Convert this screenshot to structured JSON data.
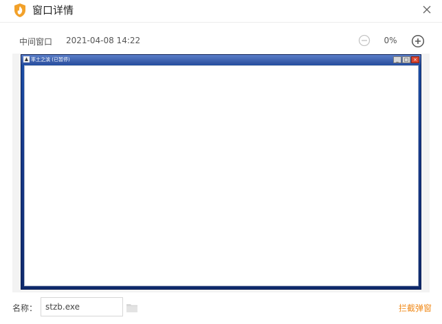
{
  "dialog": {
    "title": "窗口详情",
    "close_icon": "close-icon",
    "app_icon": "flame-shield-icon",
    "accent_color": "#f08a1a"
  },
  "info": {
    "window_type": "中间窗口",
    "timestamp": "2021-04-08 14:22",
    "zoom": "0%",
    "zoom_out_icon": "zoom-out-icon",
    "zoom_in_icon": "zoom-in-icon"
  },
  "preview": {
    "window_title": "率土之滨 (已暂停)",
    "controls": [
      "_",
      "□",
      "×"
    ]
  },
  "footer": {
    "name_label": "名称：",
    "name_value": "stzb.exe",
    "folder_icon": "folder-icon",
    "block_link": "拦截弹窗"
  }
}
